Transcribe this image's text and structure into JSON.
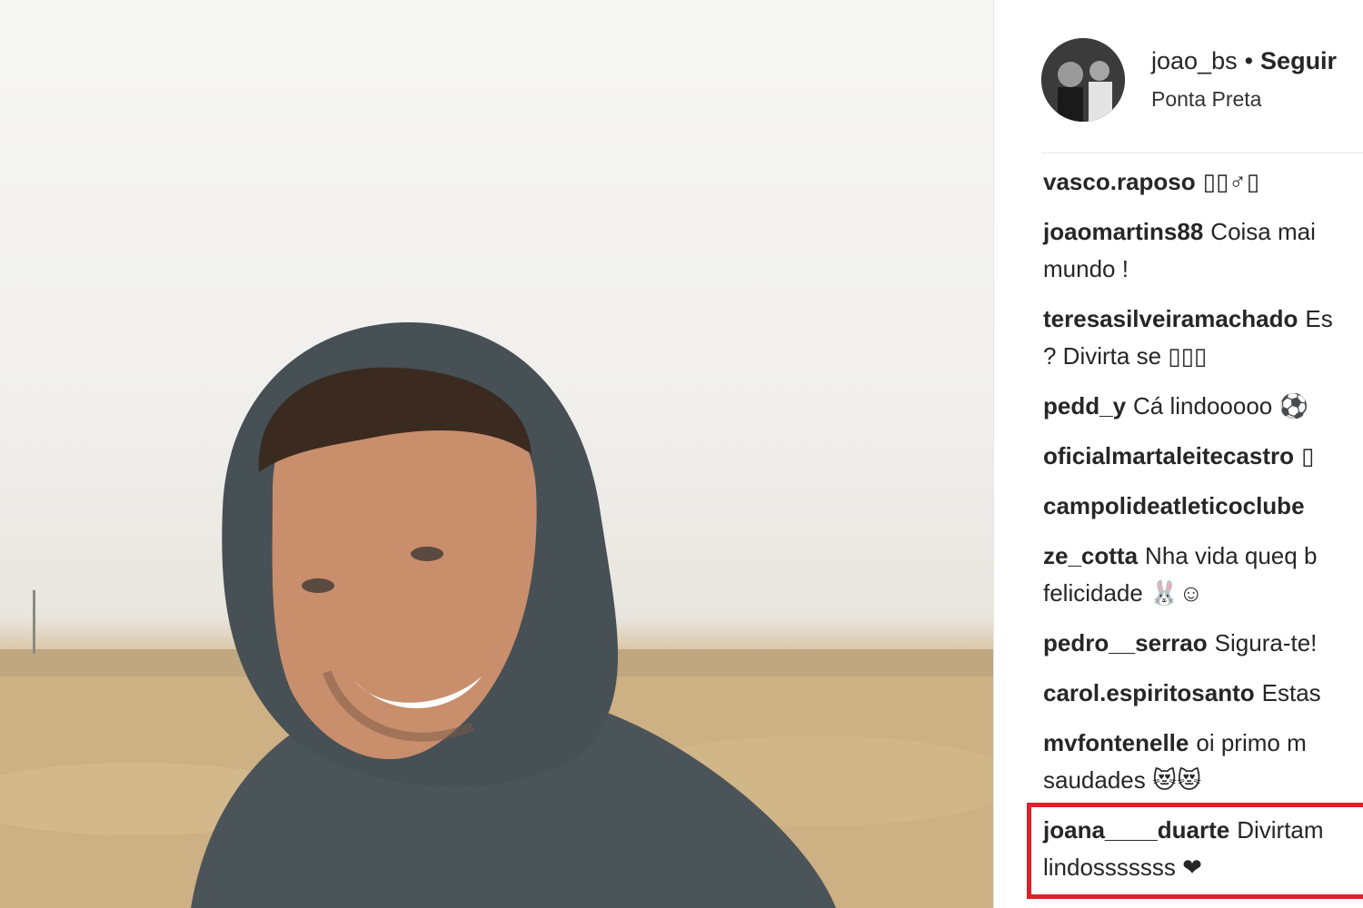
{
  "post": {
    "username": "joao_bs",
    "separator": "•",
    "follow_label": "Seguir",
    "location": "Ponta Preta"
  },
  "comments": [
    {
      "user": "vasco.raposo",
      "text": "▯▯♂▯"
    },
    {
      "user": "joaomartins88",
      "text": "Coisa mai",
      "text2": "mundo !"
    },
    {
      "user": "teresasilveiramachado",
      "text": "Es",
      "text2": "? Divirta se ▯▯▯"
    },
    {
      "user": "pedd_y",
      "text": "Cá lindooooo ⚽"
    },
    {
      "user": "oficialmartaleitecastro",
      "text": "▯"
    },
    {
      "user": "campolideatleticoclube",
      "text": ""
    },
    {
      "user": "ze_cotta",
      "text": "Nha vida queq b",
      "text2": "felicidade 🐰☺"
    },
    {
      "user": "pedro__serrao",
      "text": "Sigura-te!"
    },
    {
      "user": "carol.espiritosanto",
      "text": "Estas"
    },
    {
      "user": "mvfontenelle",
      "text": "oi primo m",
      "text2": "saudades 😻😻"
    },
    {
      "user": "joana____duarte",
      "text": "Divirtam",
      "text2": "lindosssssss ❤"
    }
  ],
  "colors": {
    "text": "#262626",
    "highlight_border": "#e0202a",
    "divider": "#e6e6e6"
  }
}
